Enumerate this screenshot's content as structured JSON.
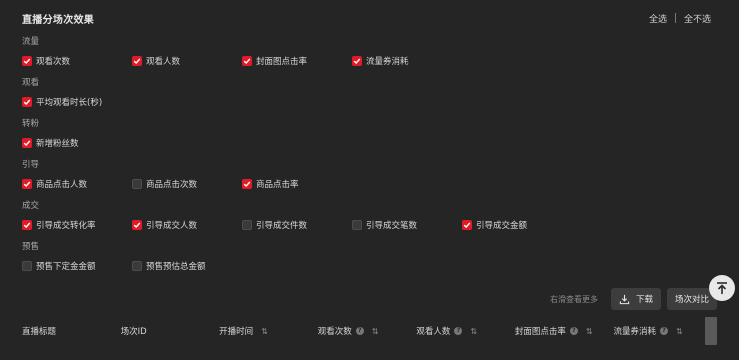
{
  "header": {
    "title": "直播分场次效果",
    "select_all": "全选",
    "select_none": "全不选"
  },
  "groups": [
    {
      "label": "流量",
      "items": [
        {
          "label": "观看次数",
          "checked": true
        },
        {
          "label": "观看人数",
          "checked": true
        },
        {
          "label": "封面图点击率",
          "checked": true
        },
        {
          "label": "流量券消耗",
          "checked": true
        }
      ]
    },
    {
      "label": "观看",
      "items": [
        {
          "label": "平均观看时长(秒)",
          "checked": true
        }
      ]
    },
    {
      "label": "转粉",
      "items": [
        {
          "label": "新增粉丝数",
          "checked": true
        }
      ]
    },
    {
      "label": "引导",
      "items": [
        {
          "label": "商品点击人数",
          "checked": true
        },
        {
          "label": "商品点击次数",
          "checked": false
        },
        {
          "label": "商品点击率",
          "checked": true
        }
      ]
    },
    {
      "label": "成交",
      "items": [
        {
          "label": "引导成交转化率",
          "checked": true
        },
        {
          "label": "引导成交人数",
          "checked": true
        },
        {
          "label": "引导成交件数",
          "checked": false
        },
        {
          "label": "引导成交笔数",
          "checked": false
        },
        {
          "label": "引导成交金额",
          "checked": true
        }
      ]
    },
    {
      "label": "预售",
      "items": [
        {
          "label": "预售下定金金额",
          "checked": false
        },
        {
          "label": "预售预估总金额",
          "checked": false
        }
      ]
    }
  ],
  "toolbar": {
    "hint": "右滑查看更多",
    "download_label": "下载",
    "compare_label": "场次对比"
  },
  "table": {
    "columns": [
      {
        "label": "直播标题",
        "help": false,
        "sort": false
      },
      {
        "label": "场次ID",
        "help": false,
        "sort": false
      },
      {
        "label": "开播时间",
        "help": false,
        "sort": true
      },
      {
        "label": "观看次数",
        "help": true,
        "sort": true
      },
      {
        "label": "观看人数",
        "help": true,
        "sort": true
      },
      {
        "label": "封面图点击率",
        "help": true,
        "sort": true
      },
      {
        "label": "流量券消耗",
        "help": true,
        "sort": true
      }
    ]
  },
  "colors": {
    "background": "#252525",
    "checkbox_on": "#e01a26",
    "button": "#3d3d3d"
  },
  "icons": [
    "check-icon",
    "download-icon",
    "back-to-top-icon",
    "help-icon",
    "sort-icon"
  ]
}
